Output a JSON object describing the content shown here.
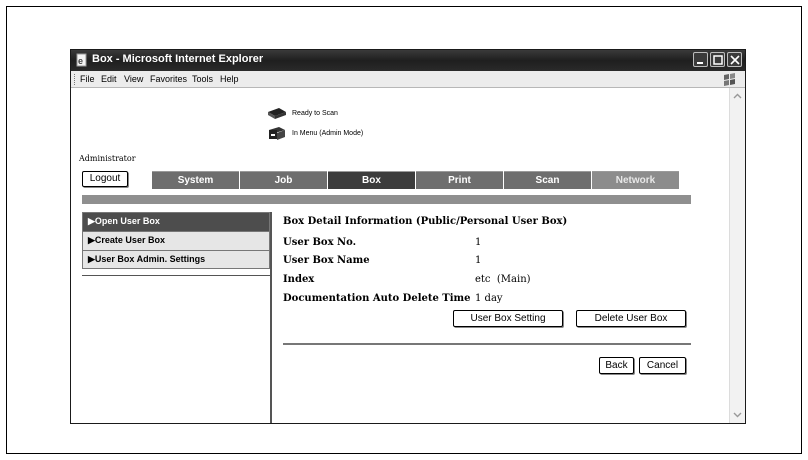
{
  "window": {
    "title": "Box - Microsoft Internet Explorer"
  },
  "menu": [
    "File",
    "Edit",
    "View",
    "Favorites",
    "Tools",
    "Help"
  ],
  "status": {
    "ready": "Ready to Scan",
    "mode": "In Menu (Admin Mode)"
  },
  "user": {
    "role": "Administrator",
    "logout_label": "Logout"
  },
  "tabs": [
    {
      "label": "System",
      "active": false
    },
    {
      "label": "Job",
      "active": false
    },
    {
      "label": "Box",
      "active": true
    },
    {
      "label": "Print",
      "active": false
    },
    {
      "label": "Scan",
      "active": false
    },
    {
      "label": "Network",
      "active": false
    }
  ],
  "sidebar": {
    "items": [
      {
        "label": "▶Open User Box",
        "active": true
      },
      {
        "label": "▶Create User Box",
        "active": false
      },
      {
        "label": "▶User Box Admin. Settings",
        "active": false
      }
    ]
  },
  "detail": {
    "title": "Box Detail Information (Public/Personal User Box)",
    "rows": [
      {
        "label": "User Box No.",
        "value": "1"
      },
      {
        "label": "User Box Name",
        "value": "1"
      },
      {
        "label": "Index",
        "value": "etc  (Main)"
      },
      {
        "label": "Documentation Auto Delete Time",
        "value": "1 day"
      }
    ]
  },
  "buttons": {
    "setting": "User Box Setting",
    "delete": "Delete User Box",
    "back": "Back",
    "cancel": "Cancel"
  },
  "icons": {
    "title": "ie-page-icon",
    "logo": "windows-flag-icon",
    "status_ready": "scanner-icon",
    "status_mode": "printer-icon"
  },
  "colors": {
    "titlebar": "#2a2a2a",
    "tab": "#6e6e6e",
    "tab_active": "#3c3c3c",
    "sidebar_active": "#4d4d4d"
  }
}
